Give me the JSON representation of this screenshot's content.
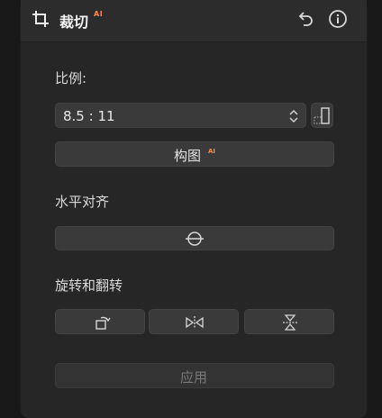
{
  "header": {
    "title": "裁切",
    "ai_badge": "AI",
    "icons": [
      "crop-icon",
      "undo-icon",
      "info-icon"
    ]
  },
  "ratio": {
    "label": "比例:",
    "selected": "8.5 : 11"
  },
  "compose": {
    "label": "构图",
    "ai_badge": "AI"
  },
  "leveling": {
    "label": "水平对齐"
  },
  "rotate_flip": {
    "label": "旋转和翻转",
    "icons": [
      "rotate-icon",
      "flip-horizontal-icon",
      "flip-vertical-icon"
    ]
  },
  "apply": {
    "label": "应用"
  },
  "colors": {
    "accent": "#ff8a4c",
    "panel": "#262626",
    "button": "#3a3a3a"
  }
}
